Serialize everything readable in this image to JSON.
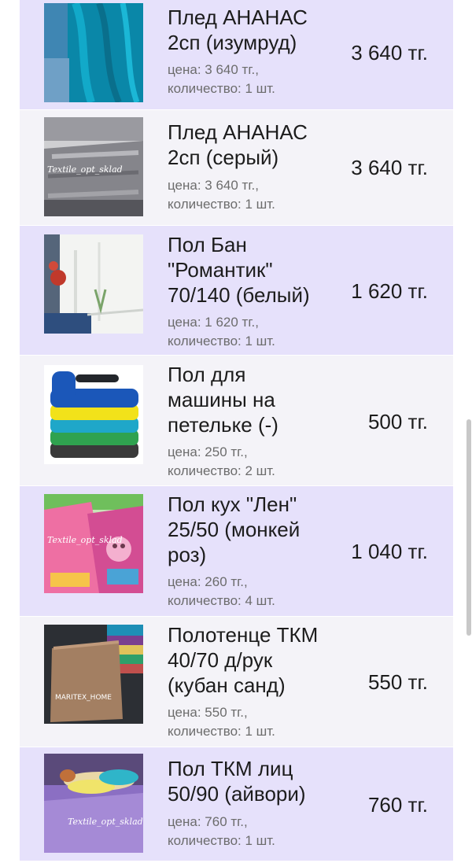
{
  "items": [
    {
      "name_lines": [
        "Плед АНАНАС",
        "2сп (изумруд)"
      ],
      "price_line": "цена: 3 640 тг.,",
      "qty_line": "количество: 1 шт.",
      "total": "3 640 тг.",
      "thumb_watermark": ""
    },
    {
      "name_lines": [
        "Плед АНАНАС",
        "2сп (серый)"
      ],
      "price_line": "цена: 3 640 тг.,",
      "qty_line": "количество: 1 шт.",
      "total": "3 640 тг.",
      "thumb_watermark": "Textile_opt_sklad"
    },
    {
      "name_lines": [
        "Пол Бан",
        "\"Романтик\"",
        "70/140 (белый)"
      ],
      "price_line": "цена: 1 620 тг.,",
      "qty_line": "количество: 1 шт.",
      "total": "1 620 тг.",
      "thumb_watermark": ""
    },
    {
      "name_lines": [
        "Пол для",
        "машины на",
        "петельке (-)"
      ],
      "price_line": "цена: 250 тг.,",
      "qty_line": "количество: 2 шт.",
      "total": "500 тг.",
      "thumb_watermark": ""
    },
    {
      "name_lines": [
        "Пол кух \"Лен\"",
        "25/50 (монкей",
        "роз)"
      ],
      "price_line": "цена: 260 тг.,",
      "qty_line": "количество: 4 шт.",
      "total": "1 040 тг.",
      "thumb_watermark": "Textile_opt_sklad"
    },
    {
      "name_lines": [
        "Полотенце ТКМ",
        "40/70 д/рук",
        "(кубан санд)"
      ],
      "price_line": "цена: 550 тг.,",
      "qty_line": "количество: 1 шт.",
      "total": "550 тг.",
      "thumb_watermark": "MARITEX_HOME"
    },
    {
      "name_lines": [
        "Пол ТКМ лиц",
        "50/90 (айвори)"
      ],
      "price_line": "цена: 760 тг.,",
      "qty_line": "количество: 1 шт.",
      "total": "760 тг.",
      "thumb_watermark": "Textile_opt_sklad"
    }
  ]
}
